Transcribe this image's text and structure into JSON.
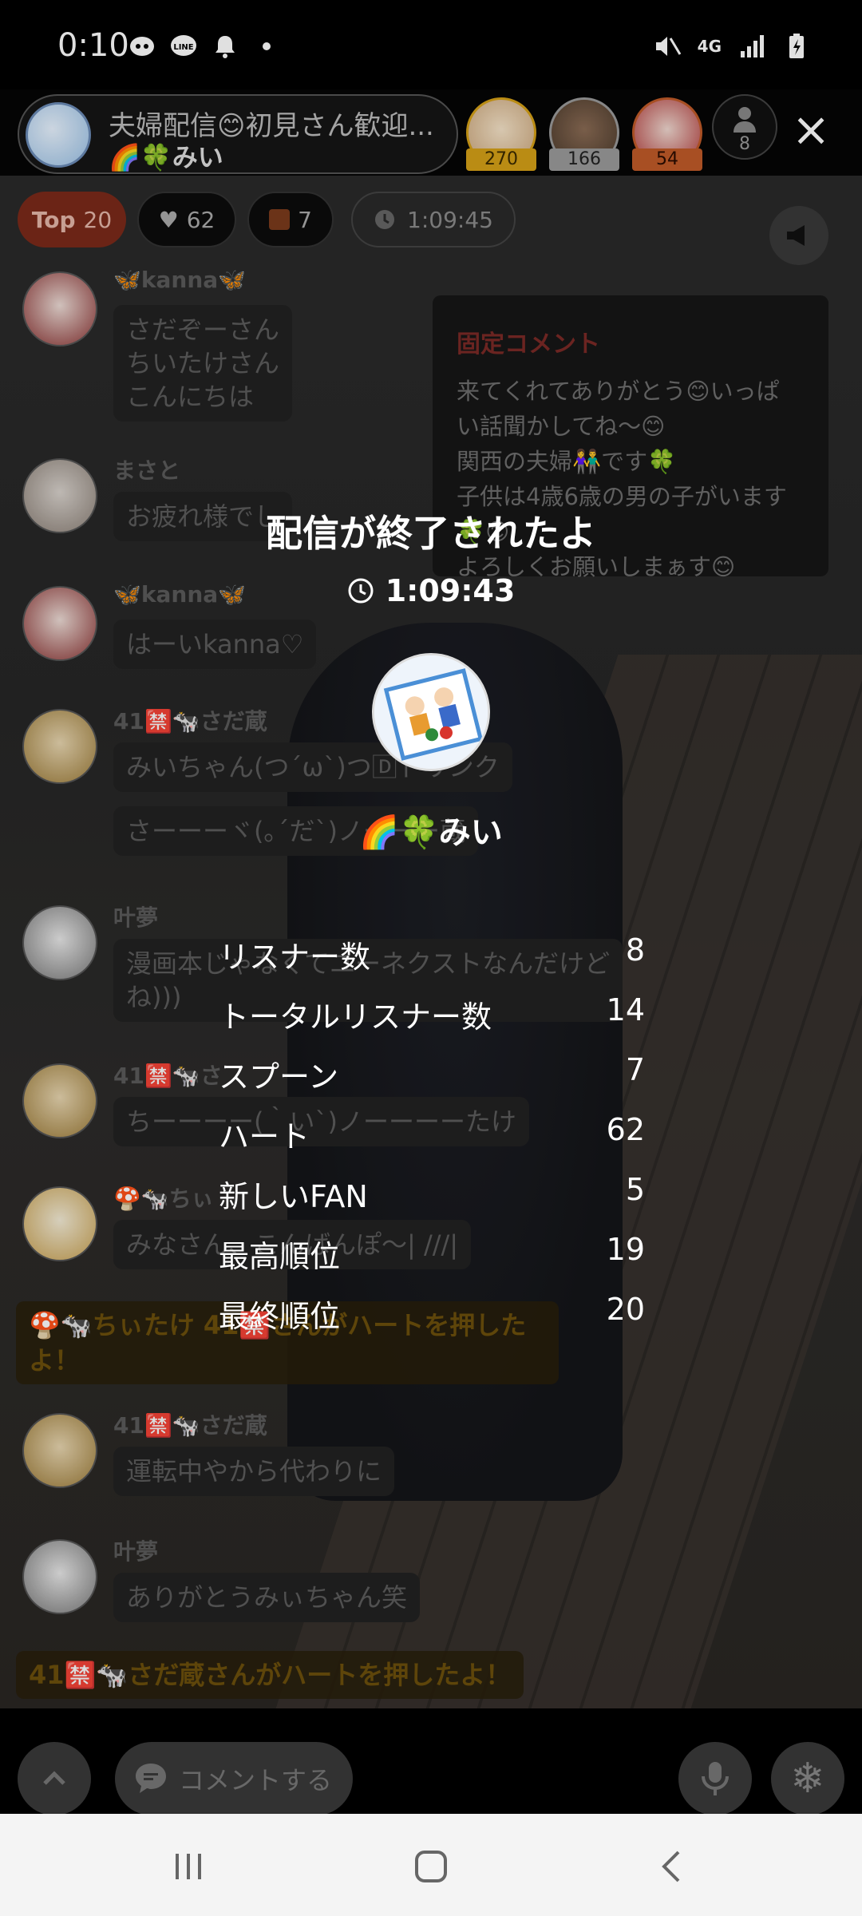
{
  "status_bar": {
    "time": "0:10",
    "network": "4G"
  },
  "header": {
    "title": "夫婦配信😊初見さん歓迎...",
    "host_name": "🌈🍀みい",
    "ranks": [
      {
        "count": "270",
        "color": "#d4a017"
      },
      {
        "count": "166",
        "color": "#9a9a9a"
      },
      {
        "count": "54",
        "color": "#c05a28"
      }
    ],
    "viewer_count": "8",
    "close_icon": "close-icon"
  },
  "chips": {
    "top_label": "Top",
    "top_value": "20",
    "hearts": "62",
    "gifts": "7",
    "elapsed": "1:09:45"
  },
  "pinned_comment": {
    "title": "固定コメント",
    "lines": [
      "来てくれてありがとう😊いっぱ",
      "い話聞かしてね〜😊",
      "関西の夫婦👫です🍀",
      "子供は4歳6歳の男の子がいます",
      "🍀😊",
      "よろしくお願いしまぁす😊"
    ]
  },
  "chat": [
    {
      "name": "🦋kanna🦋",
      "lines": [
        "さだぞーさん",
        "ちいたけさん",
        "こんにちは"
      ]
    },
    {
      "name": "まさと",
      "lines": [
        "お疲れ様でし"
      ]
    },
    {
      "name": "🦋kanna🦋",
      "lines": [
        "はーいkanna♡"
      ]
    },
    {
      "name": "41🈲🐄さだ蔵",
      "lines": [
        "みいちゃん(つ´ω`)つ🄳ドリンク"
      ]
    },
    {
      "name": "",
      "lines": [
        "さーーーヾ(｡´だ`)ノーーー蔵"
      ]
    },
    {
      "name": "叶夢",
      "lines": [
        "漫画本じゃなくてユーネクストなんだけど",
        "ね)))"
      ]
    },
    {
      "name": "41🈲🐄さ",
      "lines": [
        "ちーーーー(｀い`)ノーーーーたけ"
      ]
    },
    {
      "name": "🍄🐄ちぃ",
      "lines": [
        "みなさん、こんばんぽ〜| ///|"
      ]
    },
    {
      "name": "41🈲🐄さだ蔵",
      "lines": [
        "運転中やから代わりに"
      ]
    },
    {
      "name": "叶夢",
      "lines": [
        "ありがとうみぃちゃん笑"
      ]
    }
  ],
  "system_messages": [
    "🍄🐄ちぃたけ 41🈲さんがハートを押した",
    "よ！",
    "41🈲🐄さだ蔵さんがハートを押したよ！"
  ],
  "bottom_bar": {
    "comment_placeholder": "コメントする"
  },
  "end_summary": {
    "title": "配信が終了されたよ",
    "duration": "1:09:43",
    "host_name": "🌈🍀みい",
    "stats": [
      {
        "label": "リスナー数",
        "value": "8"
      },
      {
        "label": "トータルリスナー数",
        "value": "14"
      },
      {
        "label": "スプーン",
        "value": "7"
      },
      {
        "label": "ハート",
        "value": "62"
      },
      {
        "label": "新しいFAN",
        "value": "5"
      },
      {
        "label": "最高順位",
        "value": "19"
      },
      {
        "label": "最終順位",
        "value": "20"
      }
    ]
  }
}
